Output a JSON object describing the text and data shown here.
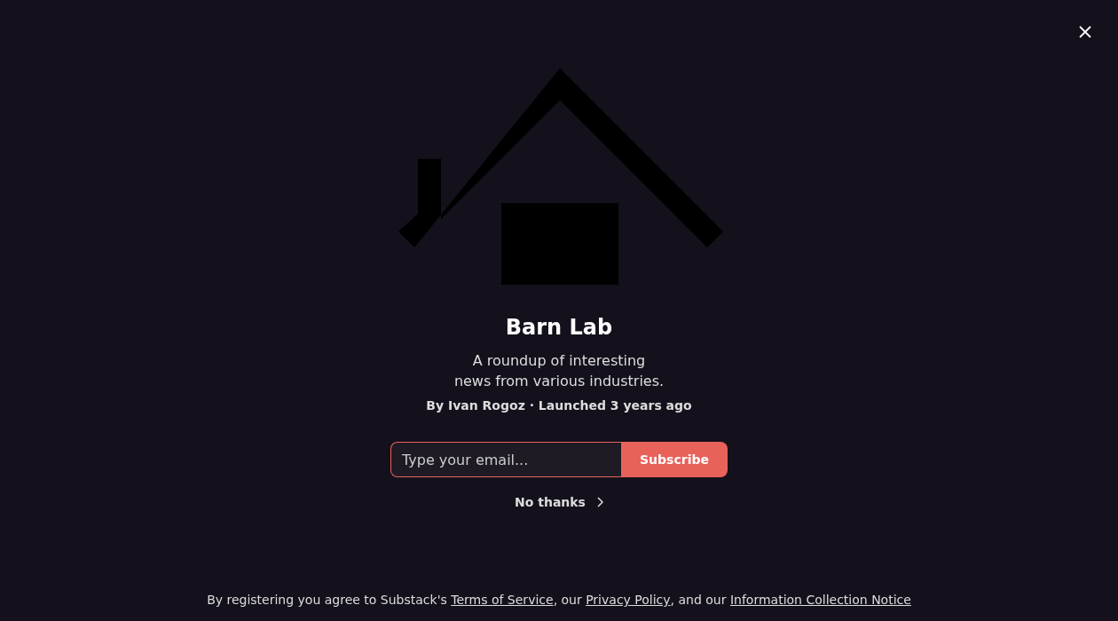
{
  "title": "Barn Lab",
  "description_lines": [
    "A roundup of interesting",
    "news from various industries."
  ],
  "byline": "By Ivan Rogoz · Launched 3 years ago",
  "email": {
    "placeholder": "Type your email..."
  },
  "subscribe_button": "Subscribe",
  "no_thanks": "No thanks",
  "footer": [
    {
      "kind": "text",
      "text": "By registering you agree to Substack's "
    },
    {
      "kind": "link",
      "text": "Terms of Service"
    },
    {
      "kind": "text",
      "text": ", our "
    },
    {
      "kind": "link",
      "text": "Privacy Policy"
    },
    {
      "kind": "text",
      "text": ", and our "
    },
    {
      "kind": "link",
      "text": "Information Collection Notice"
    }
  ]
}
